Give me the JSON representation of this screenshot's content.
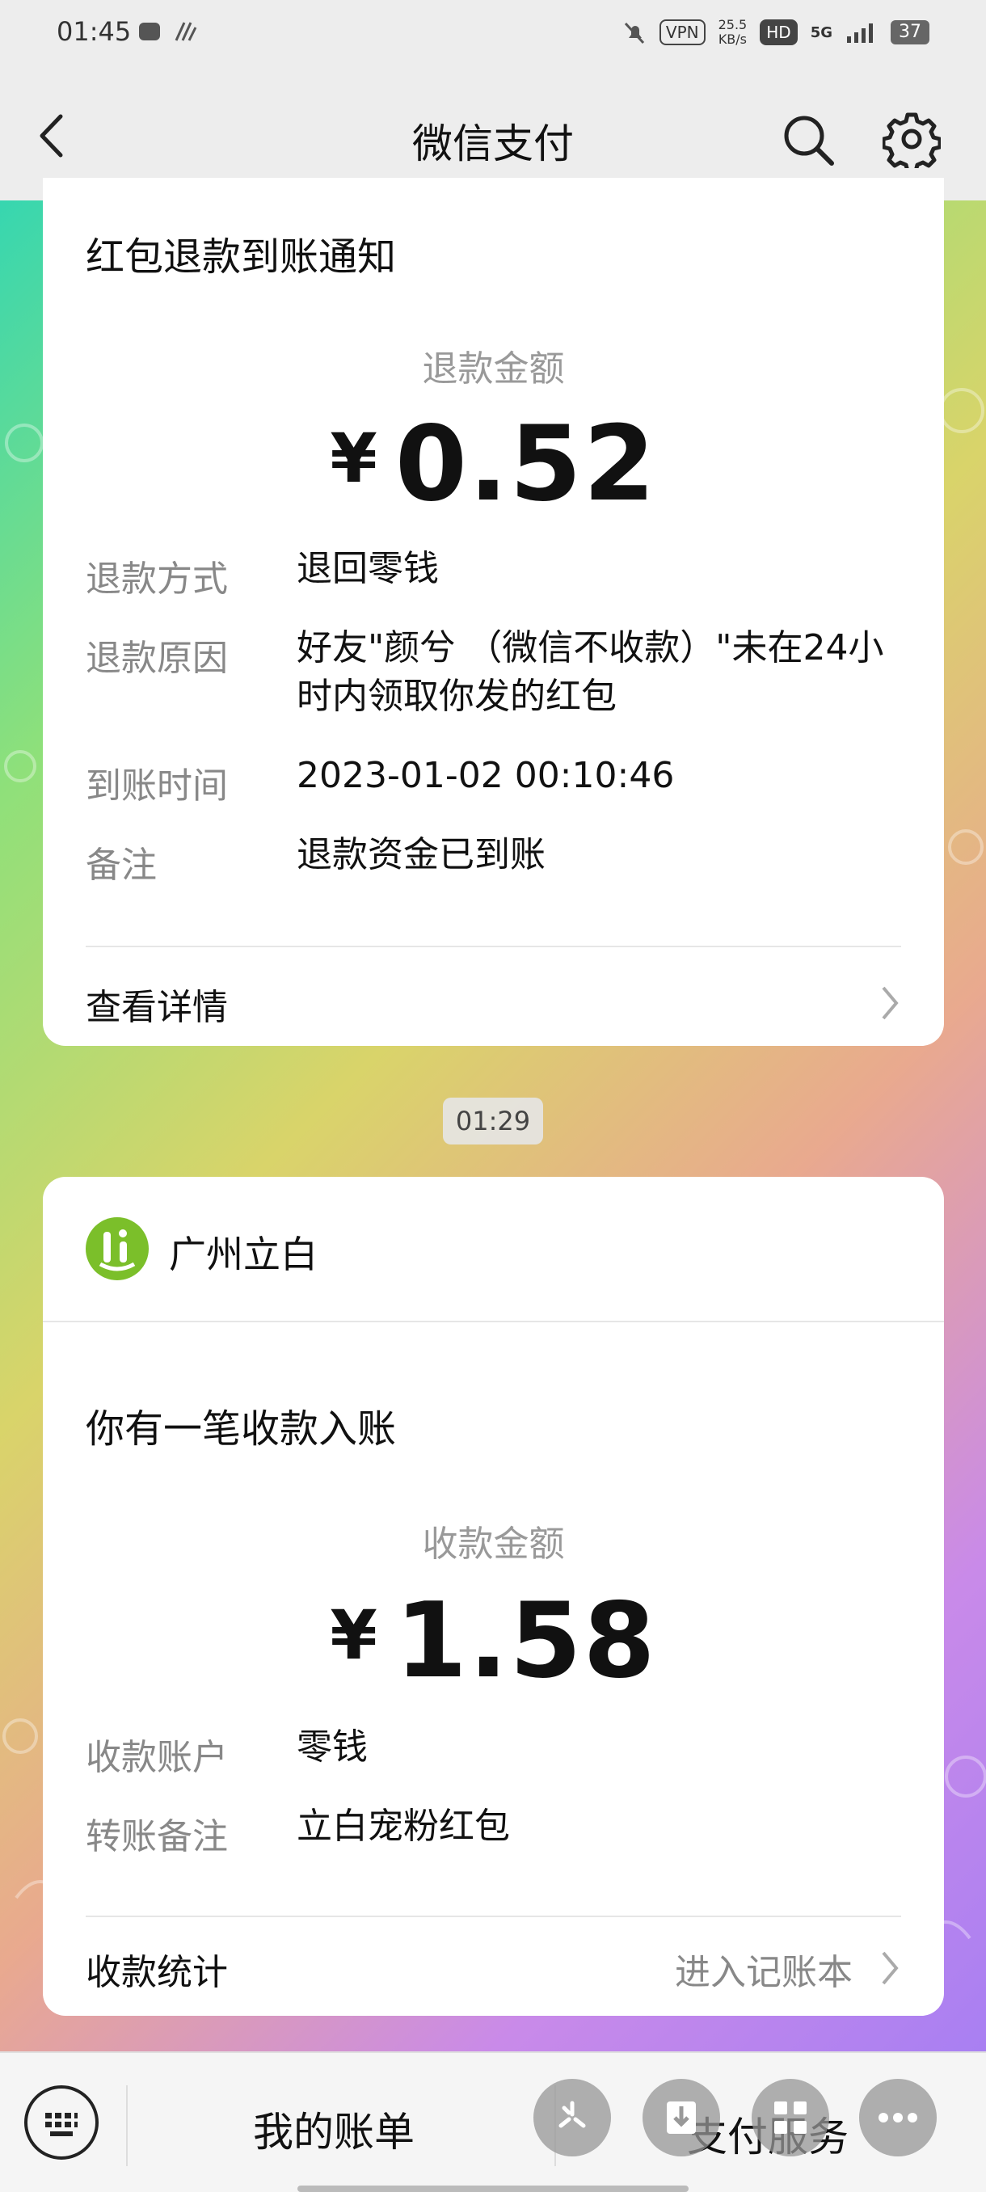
{
  "status": {
    "time": "01:45",
    "vpn": "VPN",
    "speed_top": "25.5",
    "speed_bottom": "KB/s",
    "hd": "HD",
    "net": "5G",
    "battery": "37"
  },
  "nav": {
    "title": "微信支付"
  },
  "card1": {
    "title": "红包退款到账通知",
    "amount_label": "退款金额",
    "currency": "¥",
    "amount": "0.52",
    "rows": [
      {
        "label": "退款方式",
        "value": "退回零钱"
      },
      {
        "label": "退款原因",
        "value": "好友\"颜兮 （微信不收款）\"未在24小时内领取你发的红包"
      },
      {
        "label": "到账时间",
        "value": "2023-01-02 00:10:46"
      },
      {
        "label": "备注",
        "value": "退款资金已到账"
      }
    ],
    "link": "查看详情"
  },
  "time_chip": "01:29",
  "card2": {
    "merchant": "广州立白",
    "title": "你有一笔收款入账",
    "amount_label": "收款金额",
    "currency": "¥",
    "amount": "1.58",
    "rows": [
      {
        "label": "收款账户",
        "value": "零钱"
      },
      {
        "label": "转账备注",
        "value": "立白宠粉红包"
      }
    ],
    "link": "收款统计",
    "link_right": "进入记账本"
  },
  "bottom": {
    "tab1": "我的账单",
    "tab2": "支付服务"
  },
  "icons": {
    "back": "back-arrow-icon",
    "search": "search-icon",
    "settings": "gear-icon",
    "keyboard": "keyboard-icon",
    "chevron": "chevron-right-icon"
  }
}
